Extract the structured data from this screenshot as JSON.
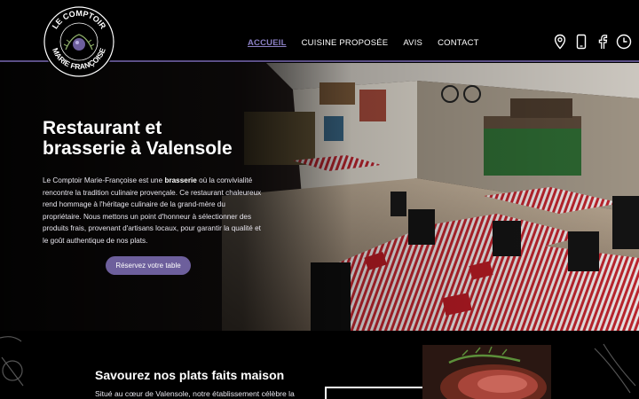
{
  "brand": {
    "logo_text_top": "LE COMPTOIR",
    "logo_text_bottom": "MARIE FRANÇOISE",
    "accent": "#6d5f9c",
    "nav_active_color": "#8b80c5"
  },
  "nav": {
    "items": [
      {
        "label": "ACCUEIL",
        "active": true
      },
      {
        "label": "CUISINE PROPOSÉE",
        "active": false
      },
      {
        "label": "AVIS",
        "active": false
      },
      {
        "label": "CONTACT",
        "active": false
      }
    ]
  },
  "header_icons": [
    "location-pin-icon",
    "phone-icon",
    "facebook-icon",
    "clock-icon"
  ],
  "hero": {
    "title_line1": "Restaurant et",
    "title_line2": "brasserie à Valensole",
    "body_part1": "Le Comptoir Marie-Françoise est une ",
    "body_bold": "brasserie",
    "body_part2": " où la convivialité rencontre la tradition culinaire provençale. Ce restaurant chaleureux rend hommage à l'héritage culinaire de la grand-mère du propriétaire. Nous mettons un point d'honneur à sélectionner des produits frais, provenant d'artisans locaux, pour garantir la qualité et le goût authentique de nos plats.",
    "cta_label": "Réservez votre table"
  },
  "section2": {
    "title": "Savourez nos plats faits maison",
    "text": "Situé au cœur de Valensole, notre établissement célèbre la"
  }
}
